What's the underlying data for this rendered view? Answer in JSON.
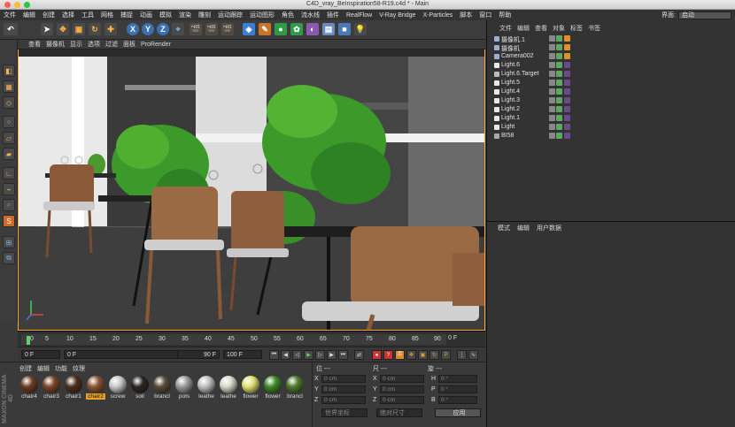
{
  "window": {
    "title": "C4D_vray_BeInspiration58-R19.c4d * - Main"
  },
  "menu": [
    "文件",
    "编辑",
    "创建",
    "选择",
    "工具",
    "网格",
    "捕捉",
    "动画",
    "模拟",
    "渲染",
    "雕刻",
    "运动跟踪",
    "运动图形",
    "角色",
    "流水线",
    "插件",
    "RealFlow",
    "V-Ray Bridge",
    "X-Particles",
    "脚本",
    "窗口",
    "帮助"
  ],
  "layout": {
    "label": "界面:",
    "value": "启动"
  },
  "toolbar": {
    "x_label": "X",
    "y_label": "Y",
    "z_label": "Z"
  },
  "viewport": {
    "menu": [
      "查看",
      "摄像机",
      "显示",
      "选项",
      "过滤",
      "面板",
      "ProRender"
    ]
  },
  "timeline": {
    "ticks": [
      "0",
      "5",
      "10",
      "15",
      "20",
      "25",
      "30",
      "35",
      "40",
      "45",
      "50",
      "55",
      "60",
      "65",
      "70",
      "75",
      "80",
      "85",
      "90"
    ],
    "current_frame": "0 F",
    "start": "0 F",
    "range_start": "0 F",
    "range_end": "90 F",
    "end": "100 F"
  },
  "materials": {
    "menu": [
      "创建",
      "编辑",
      "功能",
      "纹理"
    ],
    "brand": "MAXON CINEMA 4D",
    "items": [
      {
        "label": "chair4",
        "color": "#6b3c22"
      },
      {
        "label": "chair3",
        "color": "#7a4628"
      },
      {
        "label": "chair1",
        "color": "#4a3020"
      },
      {
        "label": "chair2",
        "color": "#8a5632",
        "selected": true
      },
      {
        "label": "screw",
        "color": "#c8c8c8"
      },
      {
        "label": "soil",
        "color": "#2a2520"
      },
      {
        "label": "brancl",
        "color": "#5a4a3a"
      },
      {
        "label": "pots",
        "color": "#9a9a9a"
      },
      {
        "label": "leathe",
        "color": "#bfbfbf"
      },
      {
        "label": "leathe",
        "color": "#d8d8c8"
      },
      {
        "label": "flower",
        "color": "#e0e070"
      },
      {
        "label": "flower",
        "color": "#3c8a28"
      },
      {
        "label": "brancl",
        "color": "#4e7a2a"
      }
    ]
  },
  "coords": {
    "header_left": "位 ---",
    "header_mid": "尺 ---",
    "header_right": "旋 ---",
    "rows": [
      {
        "a": "X",
        "av": "0 cm",
        "b": "X",
        "bv": "0 cm",
        "c": "H",
        "cv": "0 °"
      },
      {
        "a": "Y",
        "av": "0 cm",
        "b": "Y",
        "bv": "0 cm",
        "c": "P",
        "cv": "0 °"
      },
      {
        "a": "Z",
        "av": "0 cm",
        "b": "Z",
        "bv": "0 cm",
        "c": "B",
        "cv": "0 °"
      }
    ],
    "mode1": "世界坐标",
    "mode2": "绝对尺寸",
    "apply": "应用"
  },
  "objects": {
    "menu": [
      "文件",
      "编辑",
      "查看",
      "对象",
      "标签",
      "书签"
    ],
    "items": [
      {
        "name": "摄像机.1",
        "icon": "camera-icon"
      },
      {
        "name": "摄像机",
        "icon": "camera-icon"
      },
      {
        "name": "Camera002",
        "icon": "camera-icon"
      },
      {
        "name": "Light.6",
        "icon": "light-icon"
      },
      {
        "name": "Light.6.Target",
        "icon": "null-icon"
      },
      {
        "name": "Light.5",
        "icon": "light-icon"
      },
      {
        "name": "Light.4",
        "icon": "light-icon"
      },
      {
        "name": "Light.3",
        "icon": "light-icon"
      },
      {
        "name": "Light.2",
        "icon": "light-icon"
      },
      {
        "name": "Light.1",
        "icon": "light-icon"
      },
      {
        "name": "Light",
        "icon": "light-icon"
      },
      {
        "name": "BI58",
        "icon": "group-icon"
      }
    ]
  },
  "attributes": {
    "menu": [
      "模式",
      "编辑",
      "用户数据"
    ]
  },
  "colors": {
    "accent": "#ff9f3a",
    "bg": "#333333",
    "panel": "#3a3a3a"
  }
}
